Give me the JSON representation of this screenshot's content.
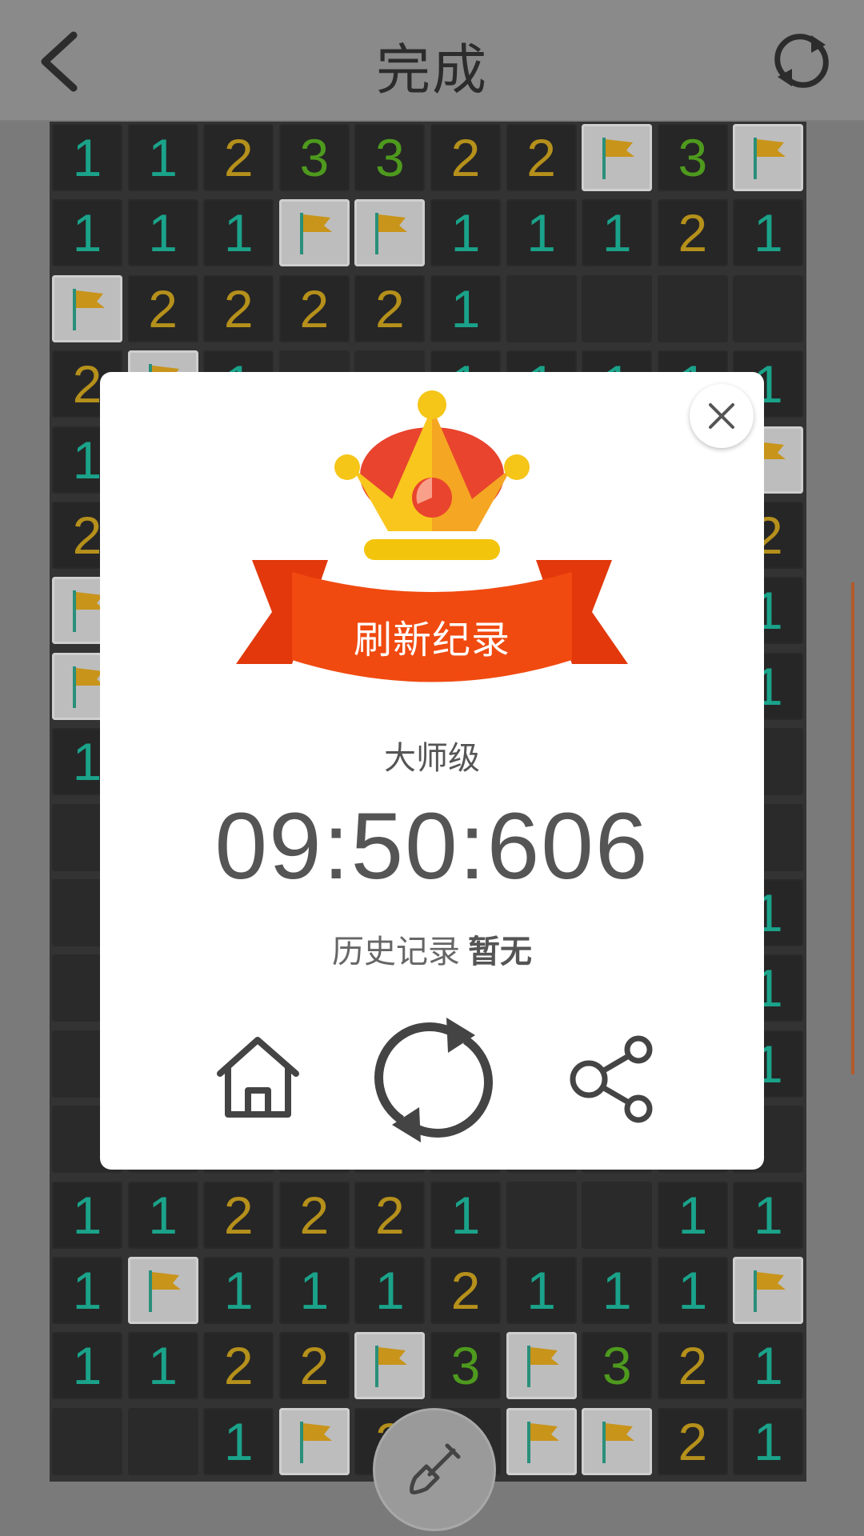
{
  "header": {
    "title": "完成",
    "back_icon": "chevron-left-icon",
    "refresh_icon": "refresh-icon"
  },
  "board": {
    "rows": [
      [
        "1",
        "1",
        "2",
        "3",
        "3",
        "2",
        "2",
        "F",
        "3",
        "F"
      ],
      [
        "1",
        "1",
        "1",
        "F",
        "F",
        "1",
        "1",
        "1",
        "2",
        "1"
      ],
      [
        "F",
        "2",
        "2",
        "2",
        "2",
        "1",
        "",
        "",
        "",
        ""
      ],
      [
        "2",
        "F",
        "1",
        "",
        "",
        "1",
        "1",
        "1",
        "1",
        "1"
      ],
      [
        "1",
        "",
        "",
        "",
        "",
        "",
        "",
        "",
        "",
        "F"
      ],
      [
        "2",
        "",
        "",
        "",
        "",
        "",
        "",
        "",
        "",
        "2"
      ],
      [
        "F",
        "",
        "",
        "",
        "",
        "",
        "",
        "",
        "",
        "1"
      ],
      [
        "F",
        "",
        "",
        "",
        "",
        "",
        "",
        "",
        "",
        "1"
      ],
      [
        "1",
        "",
        "",
        "",
        "",
        "",
        "",
        "",
        "",
        ""
      ],
      [
        "",
        "",
        "",
        "",
        "",
        "",
        "",
        "",
        "",
        ""
      ],
      [
        "",
        "",
        "",
        "",
        "",
        "",
        "",
        "",
        "",
        "1"
      ],
      [
        "",
        "",
        "",
        "",
        "",
        "",
        "",
        "",
        "",
        "1"
      ],
      [
        "",
        "",
        "",
        "",
        "",
        "",
        "",
        "",
        "",
        "1"
      ],
      [
        "",
        "",
        "",
        "",
        "",
        "",
        "",
        "",
        "",
        ""
      ],
      [
        "1",
        "1",
        "2",
        "2",
        "2",
        "1",
        "",
        "",
        "1",
        "1"
      ],
      [
        "1",
        "F",
        "1",
        "1",
        "1",
        "2",
        "1",
        "1",
        "1",
        "F"
      ],
      [
        "1",
        "1",
        "2",
        "2",
        "F",
        "3",
        "F",
        "3",
        "2",
        "1"
      ],
      [
        "",
        "",
        "1",
        "F",
        "2",
        "",
        "F",
        "F",
        "2",
        "1"
      ]
    ]
  },
  "dialog": {
    "banner": "刷新纪录",
    "level": "大师级",
    "time": "09:50:606",
    "history_label": "历史记录",
    "history_value": "暂无",
    "close_icon": "close-icon",
    "actions": [
      {
        "icon": "home-icon"
      },
      {
        "icon": "replay-icon"
      },
      {
        "icon": "share-icon"
      }
    ]
  },
  "tool": {
    "icon": "shovel-icon"
  },
  "colors": {
    "one": "#1aa38a",
    "two": "#b5901b",
    "three": "#4e9a1e",
    "ribbon": "#e8400f",
    "crown": "#f5c518"
  }
}
